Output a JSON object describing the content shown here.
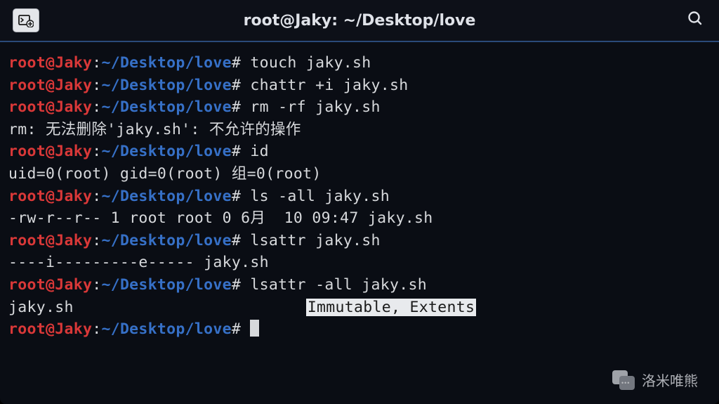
{
  "titlebar": {
    "title": "root@Jaky: ~/Desktop/love"
  },
  "prompt": {
    "user": "root@Jaky",
    "sep": ":",
    "path": "~/Desktop/love",
    "symbol": "#"
  },
  "lines": {
    "cmd1": " touch jaky.sh",
    "cmd2": " chattr +i jaky.sh",
    "cmd3": " rm -rf jaky.sh",
    "out3": "rm: 无法删除'jaky.sh': 不允许的操作",
    "cmd4": " id",
    "out4": "uid=0(root) gid=0(root) 组=0(root)",
    "cmd5": " ls -all jaky.sh",
    "out5": "-rw-r--r-- 1 root root 0 6月  10 09:47 jaky.sh",
    "cmd6": " lsattr jaky.sh",
    "out6": "----i---------e----- jaky.sh",
    "cmd7": " lsattr -all jaky.sh",
    "out7a": "jaky.sh                         ",
    "out7b": "Immutable, Extents",
    "cmd8": " "
  },
  "watermark": {
    "text": "洛米唯熊"
  }
}
